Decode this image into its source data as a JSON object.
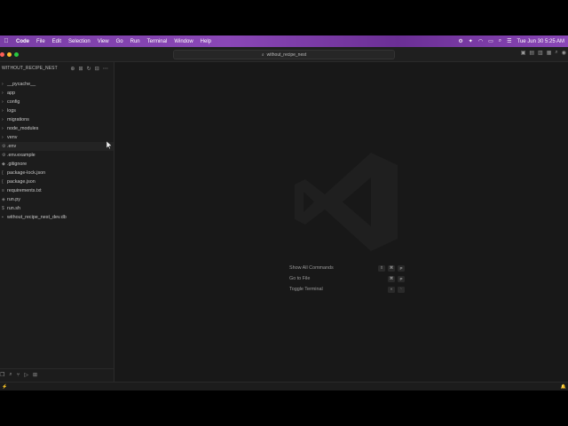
{
  "menubar": {
    "apple_icon": "apple-icon",
    "items": [
      "Code",
      "File",
      "Edit",
      "Selection",
      "View",
      "Go",
      "Run",
      "Terminal",
      "Window",
      "Help"
    ],
    "clock": "Tue Jun 30  5:25 AM",
    "status_icons": [
      "settings-icon",
      "sparkle-icon",
      "wifi-icon",
      "battery-icon",
      "search-icon",
      "control-center-icon"
    ]
  },
  "titlebar": {
    "search_text": "without_recipe_nest"
  },
  "sidebar": {
    "header": "WITHOUT_RECIPE_NEST",
    "files": [
      {
        "name": "__pycache__",
        "type": "folder"
      },
      {
        "name": "app",
        "type": "folder"
      },
      {
        "name": "config",
        "type": "folder"
      },
      {
        "name": "logs",
        "type": "folder"
      },
      {
        "name": "migrations",
        "type": "folder"
      },
      {
        "name": "node_modules",
        "type": "folder"
      },
      {
        "name": "venv",
        "type": "folder"
      },
      {
        "name": ".env",
        "type": "file"
      },
      {
        "name": ".env.example",
        "type": "file"
      },
      {
        "name": ".gitignore",
        "type": "file"
      },
      {
        "name": "package-lock.json",
        "type": "file"
      },
      {
        "name": "package.json",
        "type": "file"
      },
      {
        "name": "requirements.txt",
        "type": "file"
      },
      {
        "name": "run.py",
        "type": "file"
      },
      {
        "name": "run.sh",
        "type": "file"
      },
      {
        "name": "without_recipe_nest_dev.db",
        "type": "file"
      }
    ]
  },
  "editor": {
    "shortcuts": [
      {
        "label": "Show All Commands",
        "keys": [
          "⇧",
          "⌘",
          "P"
        ]
      },
      {
        "label": "Go to File",
        "keys": [
          "⌘",
          "P"
        ]
      },
      {
        "label": "Toggle Terminal",
        "keys": [
          "^",
          "`"
        ]
      }
    ]
  },
  "colors": {
    "menubar_accent": "#8a47b6",
    "editor_bg": "#181818",
    "sidebar_bg": "#1c1c1c"
  }
}
